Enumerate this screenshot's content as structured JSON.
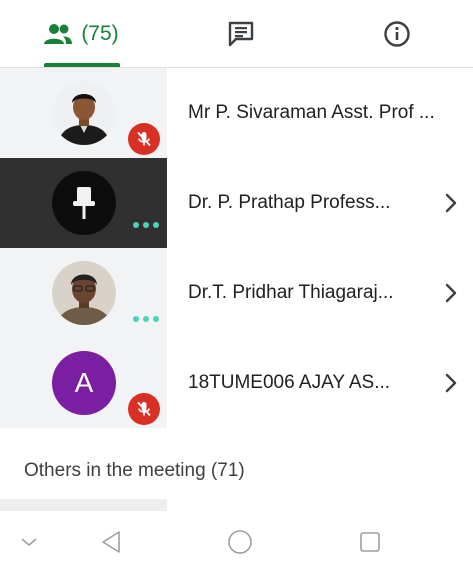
{
  "tabs": {
    "people_count": "(75)",
    "people_icon": "people-icon",
    "chat_icon": "chat-icon",
    "info_icon": "info-icon",
    "accent": "#188038"
  },
  "participants": [
    {
      "name": "Mr P. Sivaraman Asst. Prof ...",
      "status": "muted",
      "avatar": "photo"
    },
    {
      "name": "Dr. P. Prathap Profess...",
      "status": "speaking",
      "avatar": "pin-icon",
      "selected": true
    },
    {
      "name": "Dr.T. Pridhar Thiagaraj...",
      "status": "speaking",
      "avatar": "photo"
    },
    {
      "name": "18TUME006 AJAY AS...",
      "status": "muted",
      "avatar_letter": "A",
      "avatar_color": "#7b1fa2"
    }
  ],
  "others": {
    "label": "Others in the meeting (71)"
  },
  "colors": {
    "muted": "#d93025",
    "speaking_dots": "#4fd1b8",
    "selected_row": "#303030"
  }
}
